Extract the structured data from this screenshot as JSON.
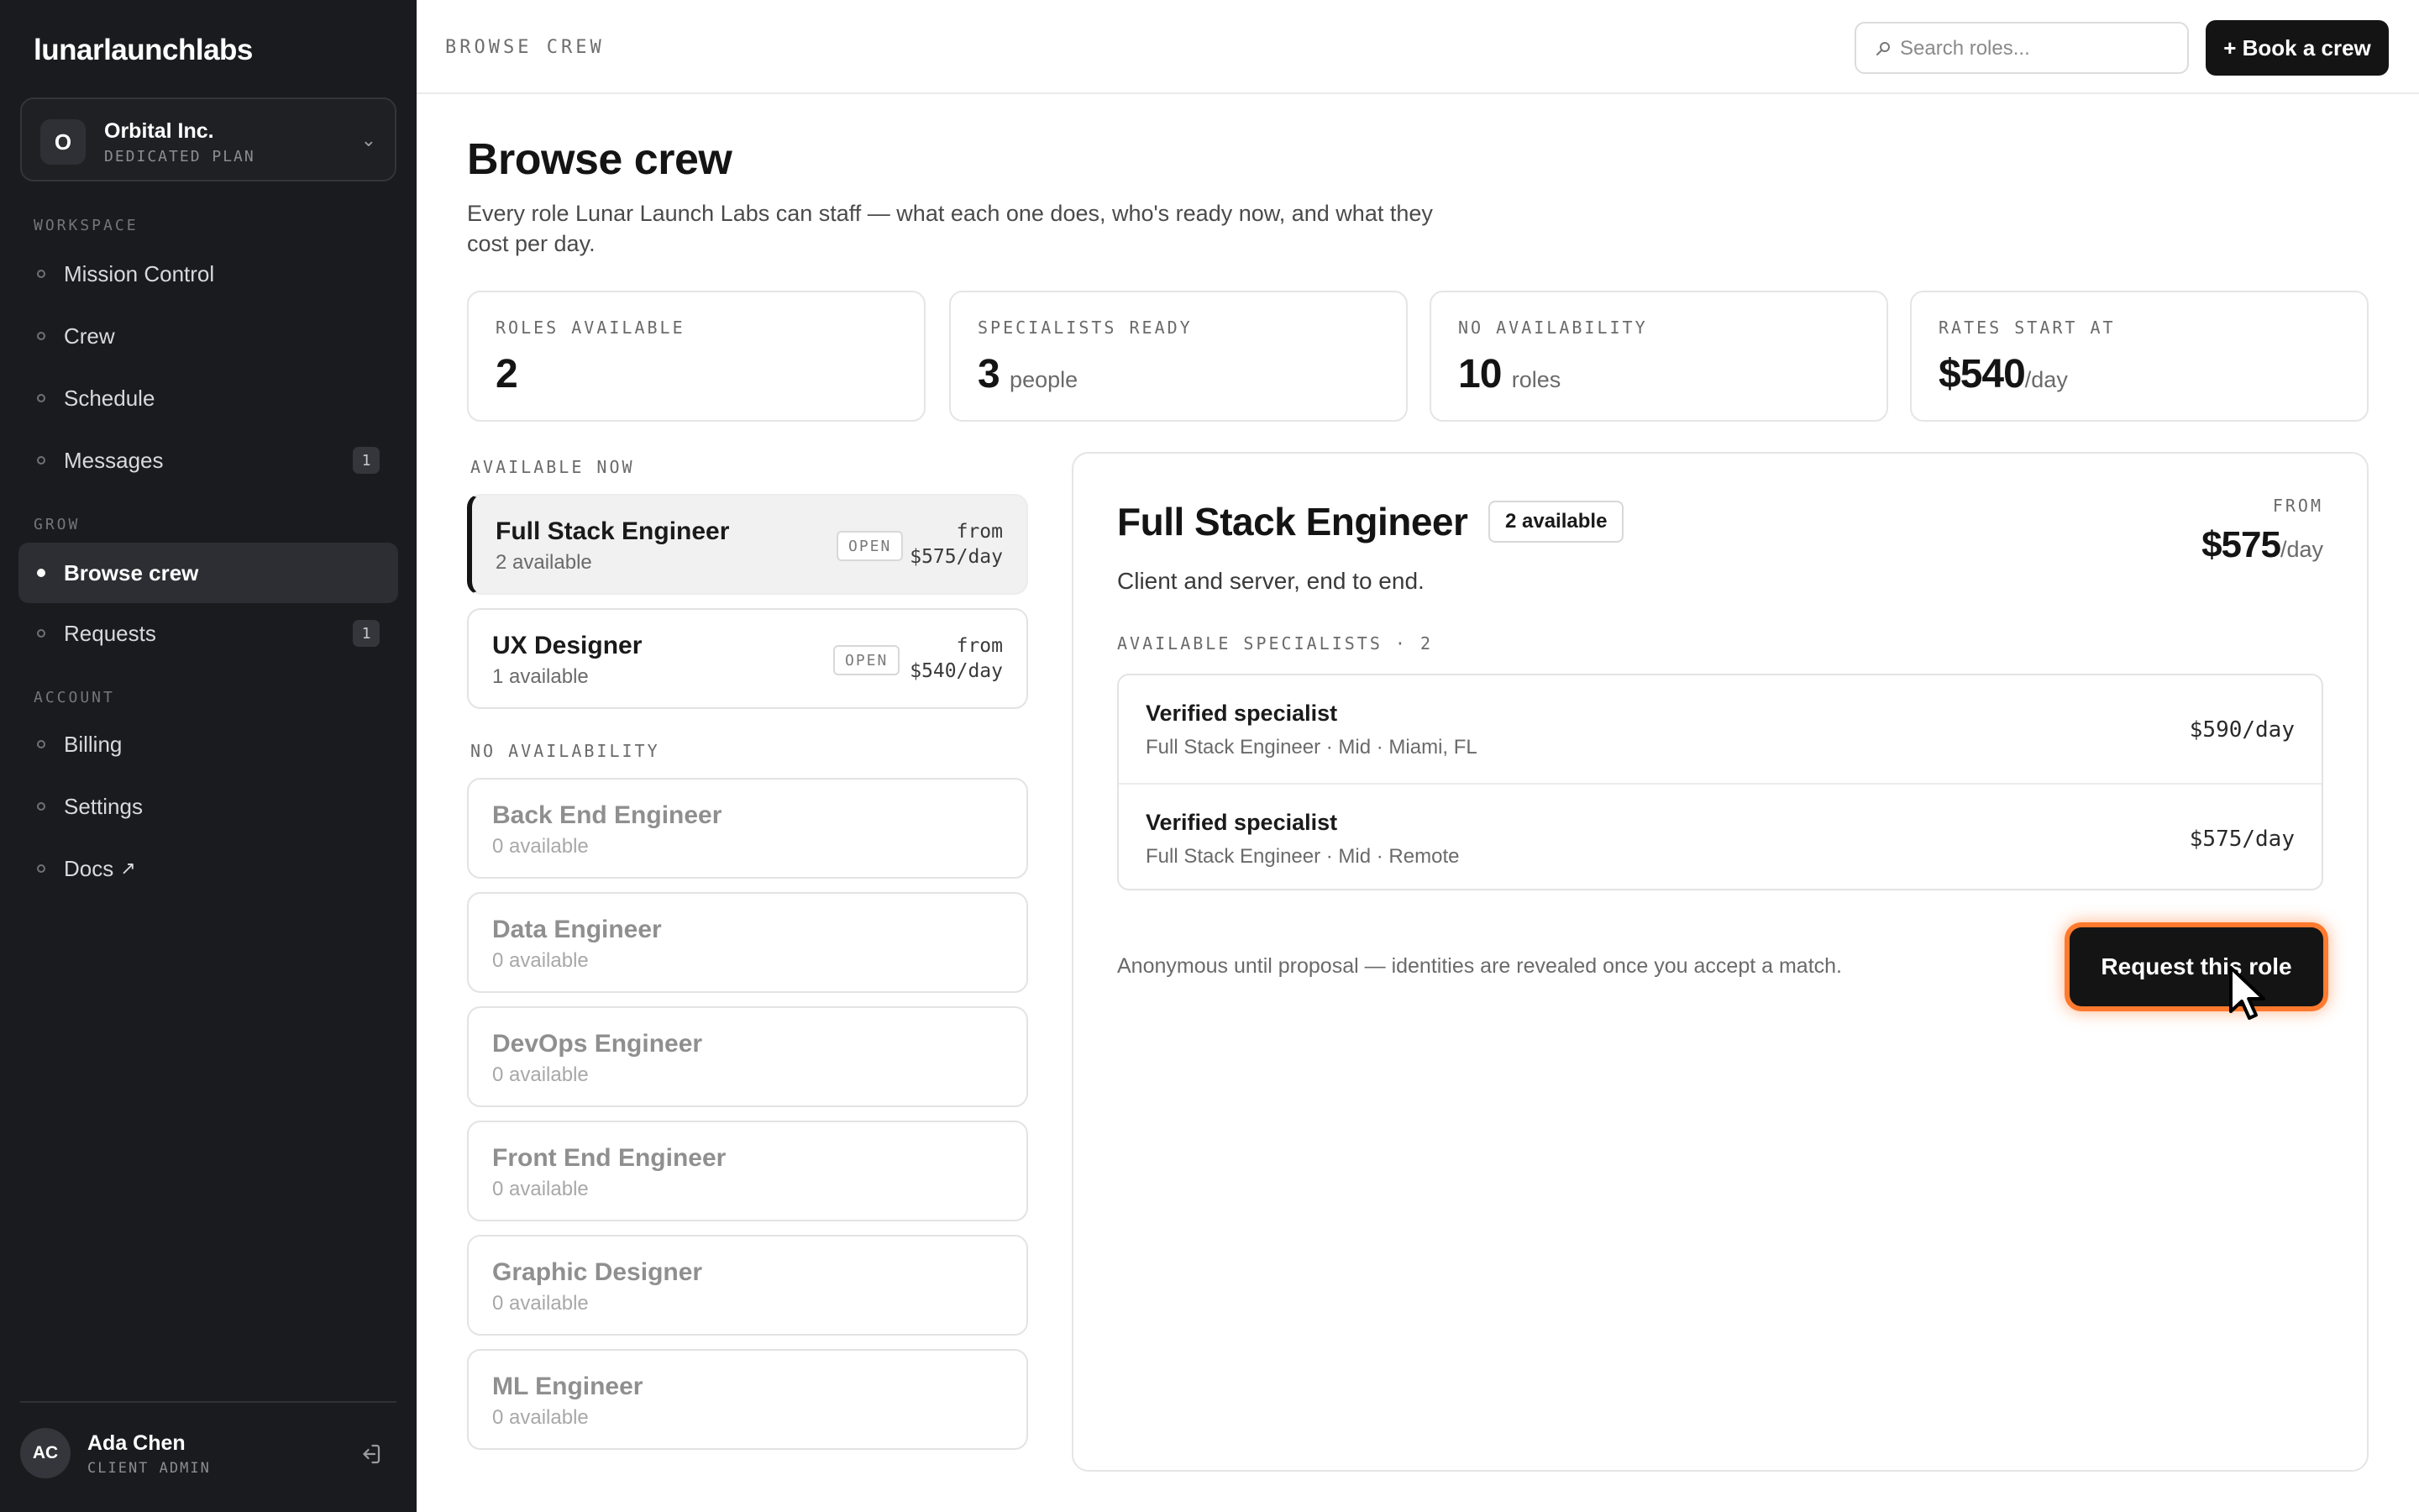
{
  "app": {
    "brand": "lunarlaunchlabs"
  },
  "org": {
    "avatar": "O",
    "name": "Orbital Inc.",
    "plan": "DEDICATED PLAN",
    "chevron": "⌄"
  },
  "sidebar": {
    "sections": [
      {
        "label": "WORKSPACE"
      },
      {
        "label": "GROW"
      },
      {
        "label": "ACCOUNT"
      }
    ],
    "items": [
      {
        "label": "Mission Control",
        "badge": ""
      },
      {
        "label": "Crew",
        "badge": ""
      },
      {
        "label": "Schedule",
        "badge": ""
      },
      {
        "label": "Messages",
        "badge": "1"
      },
      {
        "label": "Browse crew",
        "badge": "",
        "active": true
      },
      {
        "label": "Requests",
        "badge": "1"
      },
      {
        "label": "Billing",
        "badge": ""
      },
      {
        "label": "Settings",
        "badge": ""
      },
      {
        "label": "Docs",
        "badge": "",
        "external": "↗"
      }
    ]
  },
  "user": {
    "initials": "AC",
    "name": "Ada Chen",
    "role": "CLIENT ADMIN"
  },
  "topbar": {
    "breadcrumb": "BROWSE CREW",
    "search_placeholder": "Search roles...",
    "book_label": "+ Book a crew"
  },
  "page": {
    "title": "Browse crew",
    "description": "Every role Lunar Launch Labs can staff — what each one does, who's ready now, and what they cost per day."
  },
  "stats": [
    {
      "label": "ROLES AVAILABLE",
      "value": "2",
      "unit": ""
    },
    {
      "label": "SPECIALISTS READY",
      "value": "3",
      "unit": "people"
    },
    {
      "label": "NO AVAILABILITY",
      "value": "10",
      "unit": "roles"
    },
    {
      "label": "RATES START AT",
      "value": "$540",
      "unit": "/day"
    }
  ],
  "lists": {
    "available_label": "AVAILABLE NOW",
    "unavailable_label": "NO AVAILABILITY",
    "available": [
      {
        "name": "Full Stack Engineer",
        "count": "2 available",
        "tag": "OPEN",
        "price_from": "from",
        "price": "$575/day"
      },
      {
        "name": "UX Designer",
        "count": "1 available",
        "tag": "OPEN",
        "price_from": "from",
        "price": "$540/day"
      }
    ],
    "unavailable": [
      {
        "name": "Back End Engineer",
        "count": "0 available"
      },
      {
        "name": "Data Engineer",
        "count": "0 available"
      },
      {
        "name": "DevOps Engineer",
        "count": "0 available"
      },
      {
        "name": "Front End Engineer",
        "count": "0 available"
      },
      {
        "name": "Graphic Designer",
        "count": "0 available"
      },
      {
        "name": "ML Engineer",
        "count": "0 available"
      }
    ]
  },
  "detail": {
    "title": "Full Stack Engineer",
    "badge": "2 available",
    "from_label": "FROM",
    "price": "$575",
    "price_unit": "/day",
    "subtitle": "Client and server, end to end.",
    "specialists_label": "AVAILABLE SPECIALISTS · 2",
    "specialists": [
      {
        "name": "Verified specialist",
        "detail": "Full Stack Engineer · Mid · Miami, FL",
        "rate": "$590/day"
      },
      {
        "name": "Verified specialist",
        "detail": "Full Stack Engineer · Mid · Remote",
        "rate": "$575/day"
      }
    ],
    "note": "Anonymous until proposal — identities are revealed once you accept a match.",
    "request_label": "Request this role"
  },
  "colors": {
    "sidebar_bg": "#1a1b1e",
    "primary": "#141414",
    "highlight": "#ff7a2e"
  },
  "icons": {
    "search": "search-icon",
    "logout": "logout-icon",
    "chevron": "chevron-down-icon",
    "external": "external-link-icon",
    "cursor": "cursor-pointer-icon"
  }
}
